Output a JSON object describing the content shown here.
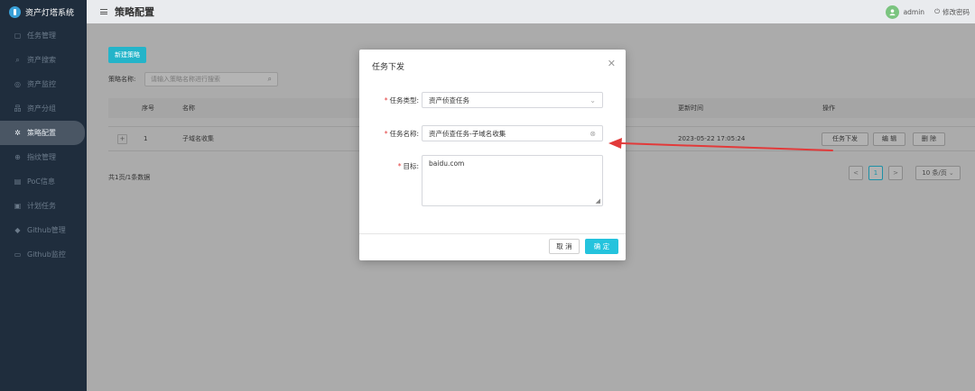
{
  "app": {
    "title": "资产灯塔系统",
    "colors": {
      "sidebar": "#1f2d3d",
      "accent": "#24c3dd",
      "required": "#e23a3a",
      "annotation_arrow": "#e23a3a"
    }
  },
  "sidebar": {
    "items": [
      {
        "icon": "clipboard-icon",
        "glyph": "▢",
        "label": "任务管理"
      },
      {
        "icon": "search-icon",
        "glyph": "⌕",
        "label": "资产搜索"
      },
      {
        "icon": "monitor-icon",
        "glyph": "◎",
        "label": "资产监控"
      },
      {
        "icon": "hierarchy-icon",
        "glyph": "品",
        "label": "资产分组"
      },
      {
        "icon": "gear-icon",
        "glyph": "✲",
        "label": "策略配置"
      },
      {
        "icon": "fingerprint-icon",
        "glyph": "⊕",
        "label": "指纹管理"
      },
      {
        "icon": "document-icon",
        "glyph": "▤",
        "label": "PoC信息"
      },
      {
        "icon": "calendar-icon",
        "glyph": "▣",
        "label": "计划任务"
      },
      {
        "icon": "github-icon",
        "glyph": "◆",
        "label": "Github管理"
      },
      {
        "icon": "screen-icon",
        "glyph": "▭",
        "label": "Github监控"
      }
    ],
    "active_index": 4
  },
  "header": {
    "title": "策略配置",
    "username": "admin",
    "change_password": "修改密码"
  },
  "toolbar": {
    "new_button": "新建策略",
    "filter_label": "策略名称:",
    "filter_placeholder": "请输入策略名称进行搜索"
  },
  "table": {
    "columns": {
      "index": "序号",
      "name": "名称",
      "updated": "更新时间",
      "actions": "操作"
    },
    "rows": [
      {
        "index": "1",
        "name": "子域名收集",
        "updated": "2023-05-22 17:05:24"
      }
    ],
    "row_actions": {
      "dispatch": "任务下发",
      "edit": "编 辑",
      "delete": "删 除"
    }
  },
  "pagination": {
    "total": "共1页/1条数据",
    "current_page": "1",
    "prev": "<",
    "next": ">",
    "page_size": "10 条/页"
  },
  "modal": {
    "title": "任务下发",
    "fields": {
      "type_label": "任务类型:",
      "type_value": "资产侦查任务",
      "name_label": "任务名称:",
      "name_value": "资产侦查任务-子域名收集",
      "target_label": "目标:",
      "target_value": "baidu.com"
    },
    "cancel": "取 消",
    "confirm": "确 定"
  }
}
